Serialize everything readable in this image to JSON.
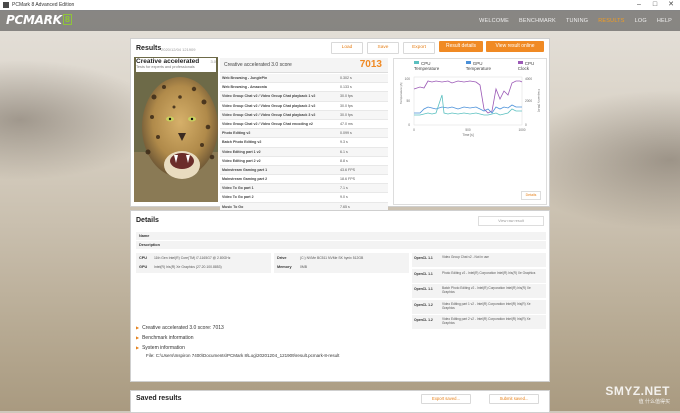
{
  "window": {
    "title": "PCMark 8 Advanced Edition",
    "minimize": "–",
    "maximize": "□",
    "close": "✕"
  },
  "nav": {
    "logo": "PCMARK",
    "logo_num": "8",
    "items": [
      "WELCOME",
      "BENCHMARK",
      "TUNING",
      "RESULTS",
      "LOG",
      "HELP"
    ],
    "active_index": 3
  },
  "results": {
    "title": "Results",
    "subtitle": "2020/12/04 121909",
    "buttons": {
      "load": "Load",
      "save": "Save",
      "export": "Export",
      "result_details": "Result details",
      "view_online": "View result online"
    },
    "test_name": "Creative accelerated",
    "test_version": "3.0",
    "test_desc": "Tests for experts and professionals",
    "score_label": "Creative accelerated 3.0 score",
    "score": "7013",
    "rows": [
      {
        "name": "Web Browsing - JunglePin",
        "value": "0.302 s"
      },
      {
        "name": "Web Browsing - Amazonia",
        "value": "0.133 s"
      },
      {
        "name": "Video Group Chat v2 / Video Group Chat playback 1 v2",
        "value": "30.0 fps"
      },
      {
        "name": "Video Group Chat v2 / Video Group Chat playback 2 v2",
        "value": "30.0 fps"
      },
      {
        "name": "Video Group Chat v2 / Video Group Chat playback 3 v2",
        "value": "30.0 fps"
      },
      {
        "name": "Video Group Chat v2 / Video Group Chat encoding v2",
        "value": "47.0 ms"
      },
      {
        "name": "Photo Editing v2",
        "value": "0.099 s"
      },
      {
        "name": "Batch Photo Editing v2",
        "value": "9.3 s"
      },
      {
        "name": "Video Editing part 1 v2",
        "value": "6.1 s"
      },
      {
        "name": "Video Editing part 2 v2",
        "value": "8.8 s"
      },
      {
        "name": "Mainstream Gaming part 1",
        "value": "43.6 FPS"
      },
      {
        "name": "Mainstream Gaming part 2",
        "value": "18.6 FPS"
      },
      {
        "name": "Video To Go part 1",
        "value": "7.1 s"
      },
      {
        "name": "Video To Go part 2",
        "value": "9.0 s"
      },
      {
        "name": "Music To Go",
        "value": "7.65 s"
      }
    ],
    "chart": {
      "legend": [
        "CPU Temperature",
        "GPU Temperature",
        "CPU Clock"
      ],
      "colors": [
        "#5bc0c0",
        "#4a90d9",
        "#9b59b6"
      ],
      "y_left_label": "Temperature [A]",
      "y_right_label": "Frequency [MHz]",
      "x_label": "Time [s]",
      "x_ticks": [
        "0",
        "500",
        "1000"
      ],
      "y_left_ticks": [
        "100",
        "50",
        "0"
      ],
      "y_right_ticks": [
        "4000",
        "2000",
        "0"
      ],
      "details": "Details"
    }
  },
  "details": {
    "title": "Details",
    "view_raw": "View raw result",
    "name_label": "Name",
    "desc_label": "Description",
    "cpu_label": "CPU",
    "cpu_value": "11th Gen Intel(R) Core(TM) i7-1165G7 @ 2.80GHz",
    "gpu_label": "GPU",
    "gpu_value": "Intel(R) Iris(R) Xe Graphics (27.20.100.8853)",
    "drive_label": "Drive",
    "drive_value": "(C:) NVMe BC511 NVMe SK hynix 512GB",
    "memory_label": "Memory",
    "memory_value": "0MB",
    "opencl": [
      {
        "label": "OpenCL 1.1",
        "value": "Video Group Chat v2 - Not in use"
      },
      {
        "label": "OpenCL 1.1",
        "value": "Photo Editing v2 - Intel(R) Corporation Intel(R) Iris(R) Xe Graphics"
      },
      {
        "label": "OpenCL 1.1",
        "value": "Batch Photo Editing v2 - Intel(R) Corporation Intel(R) Iris(R) Xe Graphics"
      },
      {
        "label": "OpenCL 1.2",
        "value": "Video Editing part 1 v2 - Intel(R) Corporation Intel(R) Iris(R) Xe Graphics"
      },
      {
        "label": "OpenCL 1.2",
        "value": "Video Editing part 2 v2 - Intel(R) Corporation Intel(R) Iris(R) Xe Graphics"
      }
    ],
    "expanders": [
      "Creative accelerated 3.0 score: 7013",
      "Benchmark information",
      "System information"
    ],
    "file": "File: C:\\Users\\Inspiron 7400\\Documents\\PCMark 8\\Log\\20201204_121909\\result.pcmark-8-result"
  },
  "saved": {
    "title": "Saved results",
    "export_saved": "Export saved...",
    "submit_saved": "Submit saved..."
  },
  "watermark": {
    "main": "SMYZ.NET",
    "sub": "值 什么值得买"
  }
}
